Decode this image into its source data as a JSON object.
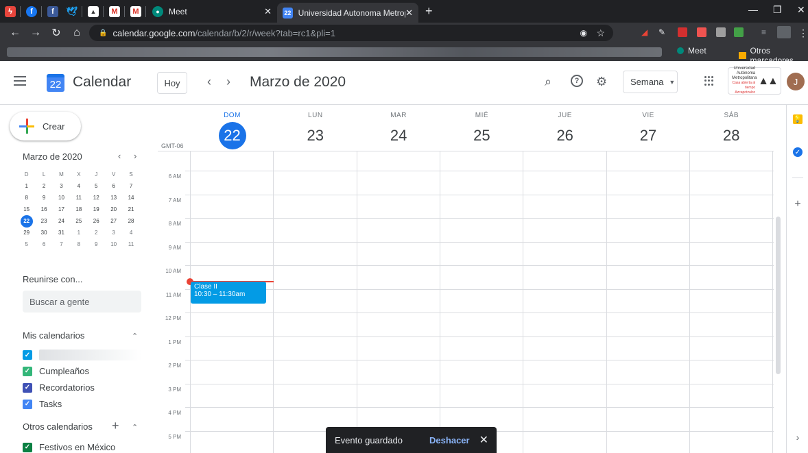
{
  "browser": {
    "tabs": [
      {
        "title": "Meet",
        "favicon": "meet-icon"
      },
      {
        "title": "Universidad Autonoma Metropol",
        "favicon": "calendar-favicon",
        "fav_text": "22"
      }
    ],
    "new_tab": "+",
    "url_host": "calendar.google.com",
    "url_path": "/calendar/b/2/r/week?tab=rc1&pli=1",
    "bookmarks": {
      "meet": "Meet",
      "others": "Otros marcadores"
    }
  },
  "header": {
    "app_title": "Calendar",
    "logo_day": "22",
    "today_button": "Hoy",
    "month_title": "Marzo de 2020",
    "view_select": "Semana",
    "avatar_initial": "J",
    "uam_logo_text": "Universidad Autónoma Metropolitana",
    "uam_logo_sub": "Casa abierta al tiempo Azcapotzalco"
  },
  "sidebar": {
    "create_label": "Crear",
    "mini_title": "Marzo de 2020",
    "weekdays": [
      "D",
      "L",
      "M",
      "X",
      "J",
      "V",
      "S"
    ],
    "weeks": [
      [
        "1",
        "2",
        "3",
        "4",
        "5",
        "6",
        "7"
      ],
      [
        "8",
        "9",
        "10",
        "11",
        "12",
        "13",
        "14"
      ],
      [
        "15",
        "16",
        "17",
        "18",
        "19",
        "20",
        "21"
      ],
      [
        "22",
        "23",
        "24",
        "25",
        "26",
        "27",
        "28"
      ],
      [
        "29",
        "30",
        "31",
        "1",
        "2",
        "3",
        "4"
      ],
      [
        "5",
        "6",
        "7",
        "8",
        "9",
        "10",
        "11"
      ]
    ],
    "meet_title": "Reunirse con...",
    "search_people": "Buscar a gente",
    "my_calendars_title": "Mis calendarios",
    "my_calendars": [
      {
        "name": "",
        "color": "#039be5"
      },
      {
        "name": "Cumpleaños",
        "color": "#33b679"
      },
      {
        "name": "Recordatorios",
        "color": "#3f51b5"
      },
      {
        "name": "Tasks",
        "color": "#4285f4"
      }
    ],
    "other_calendars_title": "Otros calendarios",
    "other_calendars": [
      {
        "name": "Festivos en México",
        "color": "#0b8043"
      }
    ]
  },
  "week": {
    "timezone": "GMT-06",
    "days": [
      {
        "name": "DOM",
        "num": "22",
        "current": true
      },
      {
        "name": "LUN",
        "num": "23"
      },
      {
        "name": "MAR",
        "num": "24"
      },
      {
        "name": "MIÉ",
        "num": "25"
      },
      {
        "name": "JUE",
        "num": "26"
      },
      {
        "name": "VIE",
        "num": "27"
      },
      {
        "name": "SÁB",
        "num": "28"
      }
    ],
    "hours": [
      "6 AM",
      "7 AM",
      "8 AM",
      "9 AM",
      "10 AM",
      "11 AM",
      "12 PM",
      "1 PM",
      "2 PM",
      "3 PM",
      "4 PM",
      "5 PM"
    ],
    "event": {
      "title": "Clase II",
      "time": "10:30 – 11:30am",
      "color": "#039be5"
    }
  },
  "snackbar": {
    "message": "Evento guardado",
    "undo": "Deshacer"
  },
  "colors": {
    "accent": "#1a73e8",
    "now_line": "#ea4335"
  }
}
